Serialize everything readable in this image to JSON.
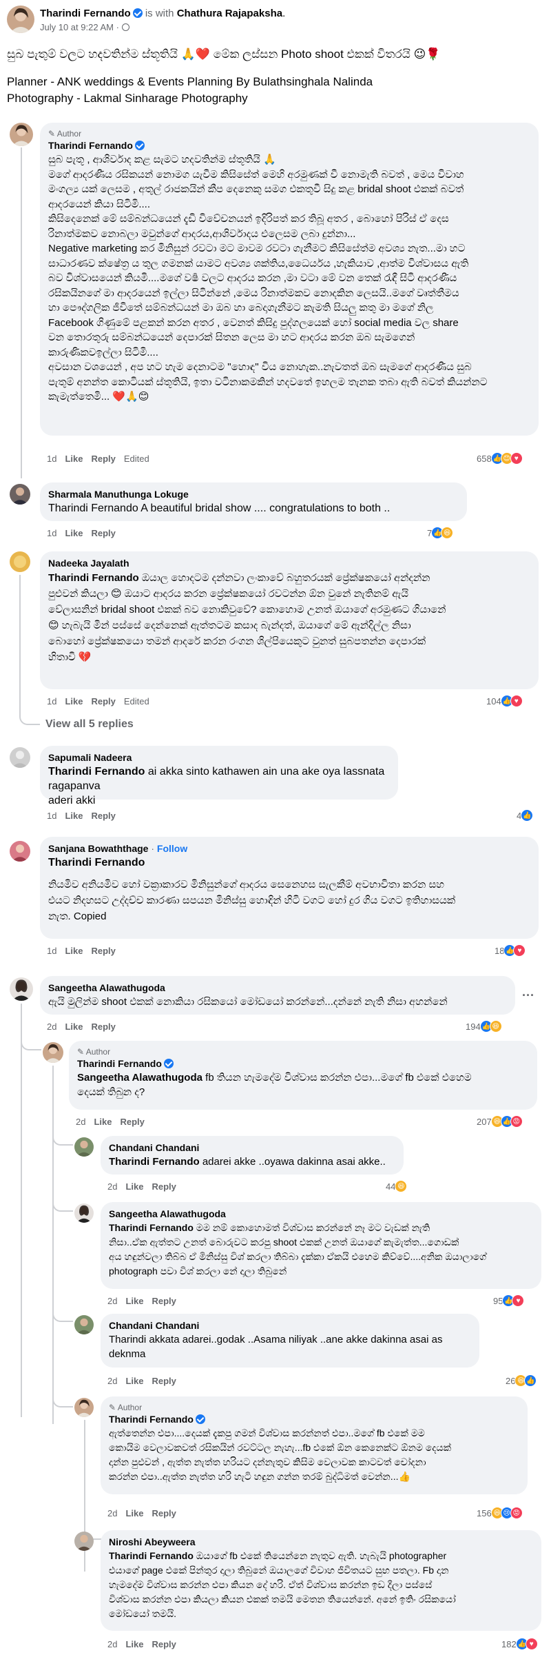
{
  "post": {
    "author": "Tharindi Fernando",
    "with_text": "is with",
    "tagged": "Chathura Rajapaksha",
    "time": "July 10 at 9:22 AM",
    "dot": "·",
    "caption": "සුබ පැතුම් වලට හදවතින්ම ස්තූතියි 🙏❤️ මේක ලස්සන Photo shoot එකක් විතරයි 😉🌹",
    "planner": "Planner - ANK weddings & Events Planning By Bulathsinghala Nalinda",
    "photography": "Photography - Lakmal Sinharage Photography"
  },
  "labels": {
    "like": "Like",
    "reply": "Reply",
    "edited": "Edited",
    "author": "Author",
    "follow": "Follow",
    "more": "···",
    "view_replies": "View all 5 replies"
  },
  "comments": [
    {
      "name": "Tharindi Fernando",
      "lines": [
        "සුබ පැතූ , ආශිර්වාද කළ සැමට හදවතින්ම ස්තූතියි 🙏",
        "මගේ ආදරණීය රසිකයන් නොමග යැවීම කිසිසේත් මෙහි අරමුණක් වී නොමැති බවත් , මෙය විවාහ",
        "මංගල්‍ය යක් ලෙසම , අතුල් රාජකයින් කීප දෙනෙකු සමග එකතුවී සිදු කළ bridal shoot එකක් බවත්",
        "ආදරයෙන් කියා සිටිමි....",
        "කිසිදෙනෙක් මේ සම්බන්ධයෙන් දැඩි විවේචනයන් ඉදිරිපත් කර තිබූ අතර , බොහෝ පිරිස් ඒ දෙස",
        "රිනාත්මකව නොබලා මවුන්ගේ ආදරය,ආශිර්වාදය එලෙසම ලබා දුන්නා...",
        "Negative marketing කර මිනිසුන් රවටා මට මාවම රවටා ගැනීමට කිසිසේත්ම අවශ්‍ය නැත...මා හට",
        "සාධාරණව ක්ෂේත්‍ර ය තුල ගමනක් යාමට අවශ්‍ය ශක්තිය,ධෛර්යය ,හැකියාව ,ආත්ම විශ්වාසය ඇති",
        "බව විශ්වාසයෙන් කියමි....මගේ වර්‍ෂ වලට ආදරය කරන ,මා වටා මේ වන තෙක් රැඳී සිටි ආදරණීය",
        "රසිකයිනගේ මා ආදරයෙන් ඉල්ලා සිටින්නේ ,මෙය රිනාත්මකව නොදකින ලෙසයි..මගේ වෘත්තීමය",
        "හා පෞද්ගලික ජීවිතේ සම්බන්ධයන් මා ඔබ හා බෙදාගැනීමට කැමති සියලු කතු මා මගේ නිල",
        "Facebook ගිණුමේ පළකන් කරන අතර , වෙනත් කිසිදු පුද්ගලයෙක් හෝ social media වල share",
        "වන තොරතුරු සම්බන්ධයෙන් දෙපාරක් සිතන ලෙස මා හට ආදරය කරන ඔබ සැමගෙන්",
        "කාරුණිකවඉල්ලා සිටිමි....",
        "අවසාන වශයෙන් , අප හට හැම දෙනාටම \"හොඳ\" විය නොහැක..නැවතත් ඔබ සැමගේ ආදරණීය සුබ",
        "පැතුම් අනන්ත කොටියක් ස්තූතියි, ඉතා වටිනාකමකින් හදවතේ ඉහලම තැනක තබා ඇති බවත් කියන්නට",
        "කැමැත්තෙමි... ❤️🙏😊"
      ],
      "time": "1d",
      "reacts": "658"
    },
    {
      "name": "Sharmala Manuthunga Lokuge",
      "text": "Tharindi Fernando A beautiful bridal show .... congratulations to both ..",
      "time": "1d",
      "reacts": "7"
    },
    {
      "name": "Nadeeka Jayalath",
      "tag": "Tharindi Fernando",
      "lines": [
        "ඔයාල හොදටම දන්නවා ලංකාවේ බහුතරයක් ප්‍රේක්ෂකයෝ අන්දන්න",
        "පුළුවන් කියලා 😊 ඔයාට ආදරය කරන ප්‍රේක්ෂකයෝ රවටන්න ඕන වුනේ නැතිනම් ඇයි",
        "වේලාසනින් bridal shoot එකක් බව නොකිවුවේ? කොහොම උනත් ඔයාගේ අරමුණට ගියානේ",
        "😊 හැබැයි මින් පස්සේ දෙන්නෙක් ඇත්තටම කසාද බැන්දත්, ඔයාගේ මේ ඇන්දිල්ල නිසා",
        "බොහෝ ප්‍රේක්ෂකයො තමන් ආදරේ කරන රංගන ශිල්පියෙකුට වුනත් සුබපතන්න දෙපාරක්",
        "හිතාවි 💔"
      ],
      "time": "1d",
      "reacts": "104"
    },
    {
      "name": "Sapumali Nadeera",
      "tag": "Tharindi Fernando",
      "text": "ai akka sinto kathawen ain una ake oya lassnata ragapanva",
      "text2": "aderi akki",
      "time": "1d",
      "reacts": "4"
    },
    {
      "name": "Sanjana Bowaththage",
      "tag": "Tharindi Fernando",
      "lines": [
        "නියමිව අනියමිව හෝ වක්‍රාකාරව මිනිසුන්ගේ ආදරය සෙනෙහස සැලකීම් අවභාවිතා කරන සහ",
        "එයට නිදහසට උද්දච්ච කාරණා සපයන මිනිස්සු හොඳින් හිටි වගට හෝ දුර ගිය වගට ඉතිහාසයක්",
        "නැත. Copied"
      ],
      "time": "1d",
      "reacts": "18"
    },
    {
      "name": "Sangeetha Alawathugoda",
      "text": "ඇයි මුලින්ම shoot එකක් නොකියා රසිකයෝ මෝඩයෝ කරන්නේ...දන්නේ නැති නිසා අහන්නේ",
      "time": "2d",
      "reacts": "194"
    },
    {
      "name": "Tharindi Fernando",
      "tag": "Sangeetha Alawathugoda",
      "text": "fb තියන හැමදේම විශ්වාස කරන්න එපා...මගේ fb එකේ එහෙම",
      "text2": "දෙයක් තිබුන ද?",
      "time": "2d",
      "reacts": "207"
    },
    {
      "name": "Chandani Chandani",
      "tag": "Tharindi Fernando",
      "text": "adarei akke ..oyawa dakinna asai akke..",
      "time": "2d",
      "reacts": "44"
    },
    {
      "name": "Sangeetha Alawathugoda",
      "tag": "Tharindi Fernando",
      "lines": [
        "මම නම් කොහොමත් විශ්වාස කරන්නේ නෑ මට වැඩක් නැති",
        "නිසා..ඒක ඇත්තට උනත් බොරුවට කරපු shoot එකක් උනත් ඔයාගේ කැමැත්ත...ගොඩක්",
        "අය හඳුන්වලා තිබ්බ ඒ මිනිස්සු විශ් කරලා තිබ්බා දැක්කා ඒකයි එහෙම කිව්වේ....අනික ඔයාලාගේ",
        "photograph පවා විශ් කරලා නේ දාලා තිබුනේ"
      ],
      "time": "2d",
      "reacts": "95"
    },
    {
      "name": "Chandani Chandani",
      "text": "Tharindi akkata adarei..godak ..Asama niliyak ..ane akke dakinna asai as",
      "text2": "deknma",
      "time": "2d",
      "reacts": "26"
    },
    {
      "name": "Tharindi Fernando",
      "lines": [
        "ඇත්තෙන්න එපා....දෙයක් දැකපු ගමන් විශ්වාස කරන්නත් එපා..මගේ fb එකේ මම",
        "කොයිම වෙලාවකවත් රසිකයින් රවට්ටල නැහැ...fb එකේ ඕන කෙනෙක්ට ඕනම දෙයක්",
        "දාන්න පුළුවන් , ඇත්ත නැත්ත හරියට දන්නැතුව කිසිම වෙලාවක කාටවත් චෝදනා",
        "කරන්න එපා..ඇත්ත නැත්ත හරි හැටි හඳුන ගන්න තරම් බුද්ධිමත් වෙන්න...👍"
      ],
      "time": "2d",
      "reacts": "156"
    },
    {
      "name": "Niroshi Abeyweera",
      "tag": "Tharindi Fernando",
      "lines": [
        "ඔයාගේ fb එකේ තියෙන්නෙ නැතුව ඇති. හැබැයි photographer",
        "එයාගේ page එකේ පින්තුර දාලා තිබුනේ ඔයාලගේ විවාහ ජීවිතයට සුභ පතලා. Fb දාන",
        "හැමදේම විශ්වාස කරන්න එපා කියන දේ හරි. ඒත් විශ්වාස කරන්න ඉඩ දීලා පස්සේ",
        "විශ්වාස කරන්න එපා කියලා කියන එකක් තමයි මෙතන තියෙන්නේ. අනේ ඉතිං රසිකයෝ",
        "මෝඩයෝ තමයි."
      ],
      "time": "2d",
      "reacts": "182"
    }
  ]
}
